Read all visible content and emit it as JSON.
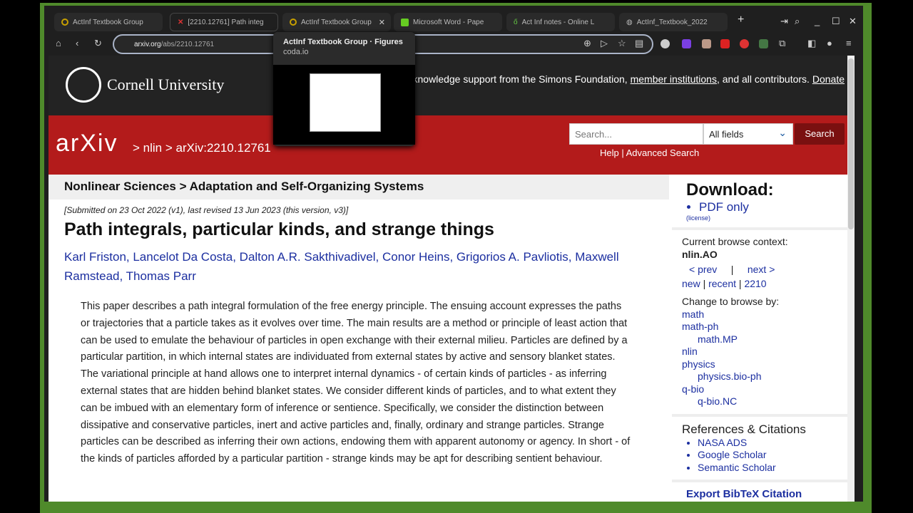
{
  "tabs": [
    {
      "label": "ActInf Textbook Group"
    },
    {
      "label": "[2210.12761] Path integ"
    },
    {
      "label": "ActInf Textbook Group"
    },
    {
      "label": "Microsoft Word - Pape"
    },
    {
      "label": "Act Inf notes - Online L"
    },
    {
      "label": "ActInf_Textbook_2022"
    }
  ],
  "url": {
    "host": "arxiv.org",
    "path": "/abs/2210.12761"
  },
  "tooltip": {
    "title": "ActInf Textbook Group · Figures",
    "domain": "coda.io"
  },
  "header": {
    "university": "Cornell University",
    "ack_text": "We gratefully acknowledge support from the Simons Foundation, ",
    "ack_link": "member institutions",
    "ack_tail": ", and all contributors. ",
    "donate": "Donate"
  },
  "arxiv": {
    "logo": "arXiv",
    "breadcrumb": "> nlin > arXiv:2210.12761",
    "search_placeholder": "Search...",
    "field": "All fields",
    "search_button": "Search",
    "help": "Help | Advanced Search"
  },
  "paper": {
    "subject": "Nonlinear Sciences > Adaptation and Self-Organizing Systems",
    "submitted": "[Submitted on 23 Oct 2022 (v1), last revised 13 Jun 2023 (this version, v3)]",
    "title": "Path integrals, particular kinds, and strange things",
    "authors": "Karl Friston, Lancelot Da Costa, Dalton A.R. Sakthivadivel, Conor Heins, Grigorios A. Pavliotis, Maxwell Ramstead, Thomas Parr",
    "abstract": "This paper describes a path integral formulation of the free energy principle. The ensuing account expresses the paths or trajectories that a particle takes as it evolves over time. The main results are a method or principle of least action that can be used to emulate the behaviour of particles in open exchange with their external milieu. Particles are defined by a particular partition, in which internal states are individuated from external states by active and sensory blanket states. The variational principle at hand allows one to interpret internal dynamics - of certain kinds of particles - as inferring external states that are hidden behind blanket states. We consider different kinds of particles, and to what extent they can be imbued with an elementary form of inference or sentience. Specifically, we consider the distinction between dissipative and conservative particles, inert and active particles and, finally, ordinary and strange particles. Strange particles can be described as inferring their own actions, endowing them with apparent autonomy or agency. In short - of the kinds of particles afforded by a particular partition - strange kinds may be apt for describing sentient behaviour."
  },
  "sidebar": {
    "download": "Download:",
    "pdf": "PDF only",
    "license": "(license)",
    "context_label": "Current browse context:",
    "context": "nlin.AO",
    "prev": "< prev",
    "sep": "|",
    "next": "next >",
    "new": "new",
    "recent": "recent",
    "yymm": "2210",
    "change": "Change to browse by:",
    "browse": [
      {
        "label": "math",
        "indent": false
      },
      {
        "label": "math-ph",
        "indent": false
      },
      {
        "label": "math.MP",
        "indent": true
      },
      {
        "label": "nlin",
        "indent": false
      },
      {
        "label": "physics",
        "indent": false
      },
      {
        "label": "physics.bio-ph",
        "indent": true
      },
      {
        "label": "q-bio",
        "indent": false
      },
      {
        "label": "q-bio.NC",
        "indent": true
      }
    ],
    "refs_title": "References & Citations",
    "refs": [
      "NASA ADS",
      "Google Scholar",
      "Semantic Scholar"
    ],
    "export": "Export BibTeX Citation"
  },
  "colors": {
    "arxiv_red": "#b31b1b",
    "link": "#1c2fa0",
    "frame_green": "#4f8a2b"
  }
}
